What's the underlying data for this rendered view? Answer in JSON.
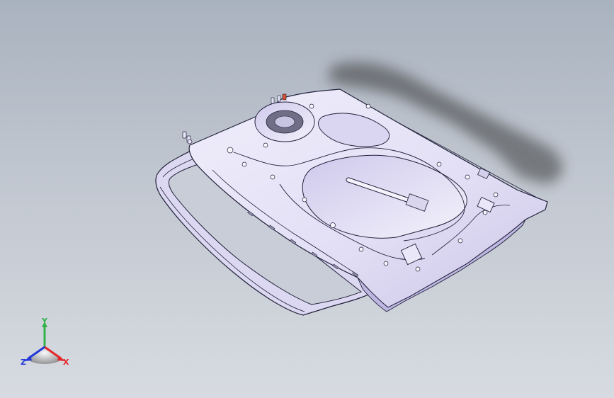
{
  "viewport": {
    "background_top": "#a9b2bf",
    "background_bottom": "#d7dbe1",
    "model_fill": "#e6e4f6",
    "model_line": "#20203a",
    "shadow_color": "#3a3a3a"
  },
  "triad": {
    "x_label": "X",
    "y_label": "Y",
    "z_label": "Z",
    "x_color": "#e3262a",
    "y_color": "#34b24a",
    "z_color": "#2438d8"
  }
}
